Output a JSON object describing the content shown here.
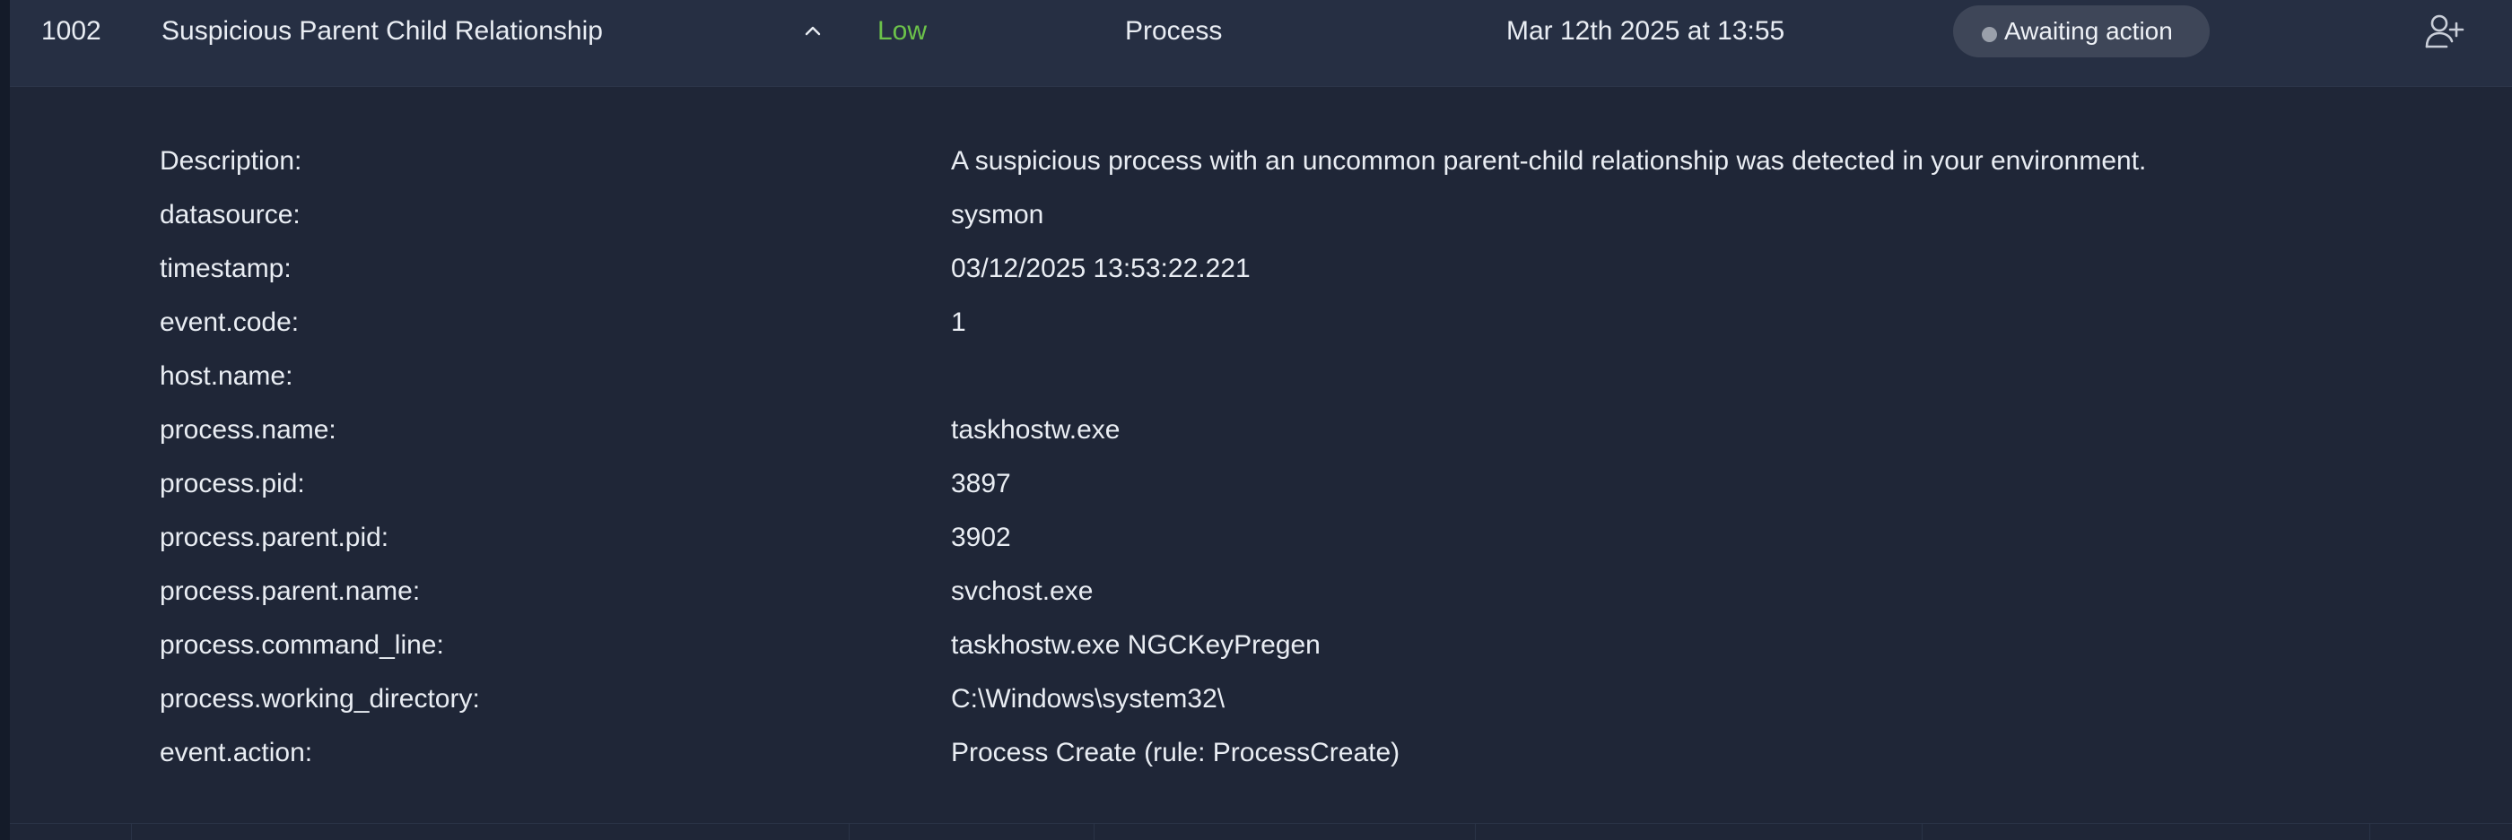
{
  "alert": {
    "id": "1002",
    "title": "Suspicious Parent Child Relationship",
    "severity": "Low",
    "type": "Process",
    "date": "Mar 12th 2025 at 13:55",
    "status": "Awaiting action",
    "expand_icon": "chevron-up-icon",
    "assign_icon": "user-plus-icon"
  },
  "details": [
    {
      "key": "Description:",
      "value": "A suspicious process with an uncommon parent-child relationship was detected in your environment."
    },
    {
      "key": "datasource:",
      "value": "sysmon"
    },
    {
      "key": "timestamp:",
      "value": "03/12/2025 13:53:22.221"
    },
    {
      "key": "event.code:",
      "value": "1"
    },
    {
      "key": "host.name:",
      "value": ""
    },
    {
      "key": "process.name:",
      "value": "taskhostw.exe"
    },
    {
      "key": "process.pid:",
      "value": "3897"
    },
    {
      "key": "process.parent.pid:",
      "value": "3902"
    },
    {
      "key": "process.parent.name:",
      "value": "svchost.exe"
    },
    {
      "key": "process.command_line:",
      "value": "taskhostw.exe NGCKeyPregen"
    },
    {
      "key": "process.working_directory:",
      "value": "C:\\Windows\\system32\\"
    },
    {
      "key": "event.action:",
      "value": "Process Create (rule: ProcessCreate)"
    }
  ],
  "colors": {
    "severity_low": "#6cc24a",
    "row_bg": "#262f43",
    "panel_bg": "#1f2637",
    "status_pill": "#3e4658",
    "status_dot": "#9aa0ab"
  }
}
